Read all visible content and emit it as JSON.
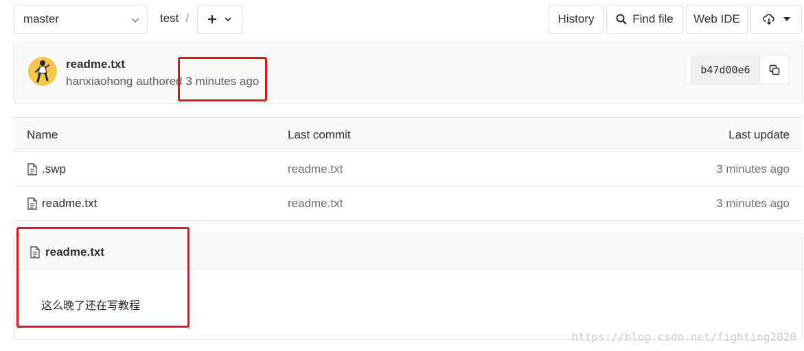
{
  "toolbar": {
    "branch": "master",
    "path_root": "test",
    "path_sep": "/",
    "history_label": "History",
    "find_file_label": "Find file",
    "web_ide_label": "Web IDE"
  },
  "last_commit": {
    "title": "readme.txt",
    "author": "hanxiaohong",
    "action": "authored",
    "time": "3 minutes ago",
    "sha": "b47d00e6"
  },
  "file_tree": {
    "headers": {
      "name": "Name",
      "last_commit": "Last commit",
      "last_update": "Last update"
    },
    "rows": [
      {
        "name": ".swp",
        "commit": "readme.txt",
        "updated": "3 minutes ago",
        "icon": "file-icon"
      },
      {
        "name": "readme.txt",
        "commit": "readme.txt",
        "updated": "3 minutes ago",
        "icon": "file-icon"
      }
    ]
  },
  "readme": {
    "filename": "readme.txt",
    "content": "这么晚了还在写教程"
  },
  "watermark": "https://blog.csdn.net/fighting2020",
  "colors": {
    "annotation": "#e8141b",
    "avatar_bg": "#f5c84a",
    "border": "#e5e5e5"
  }
}
